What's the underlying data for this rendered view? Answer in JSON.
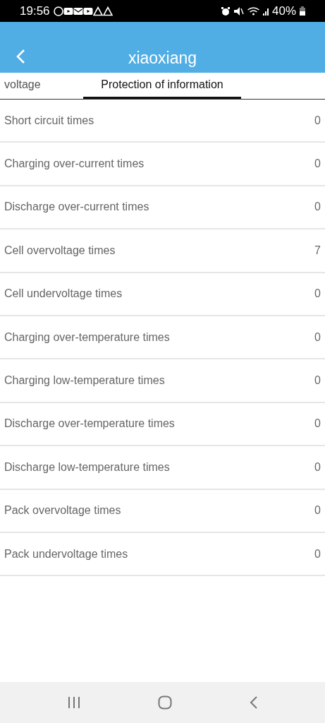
{
  "status_bar": {
    "time": "19:56",
    "battery": "40%"
  },
  "header": {
    "title": "xiaoxiang"
  },
  "tabs": [
    {
      "label": "voltage",
      "selected": false
    },
    {
      "label": "Protection of information",
      "selected": true
    }
  ],
  "rows": [
    {
      "label": "Short circuit times",
      "value": "0"
    },
    {
      "label": "Charging over-current times",
      "value": "0"
    },
    {
      "label": "Discharge over-current times",
      "value": "0"
    },
    {
      "label": "Cell overvoltage times",
      "value": "7"
    },
    {
      "label": "Cell undervoltage times",
      "value": "0"
    },
    {
      "label": "Charging over-temperature times",
      "value": "0"
    },
    {
      "label": "Charging low-temperature times",
      "value": "0"
    },
    {
      "label": "Discharge over-temperature times",
      "value": "0"
    },
    {
      "label": "Discharge low-temperature times",
      "value": "0"
    },
    {
      "label": "Pack overvoltage times",
      "value": "0"
    },
    {
      "label": "Pack undervoltage times",
      "value": "0"
    }
  ]
}
